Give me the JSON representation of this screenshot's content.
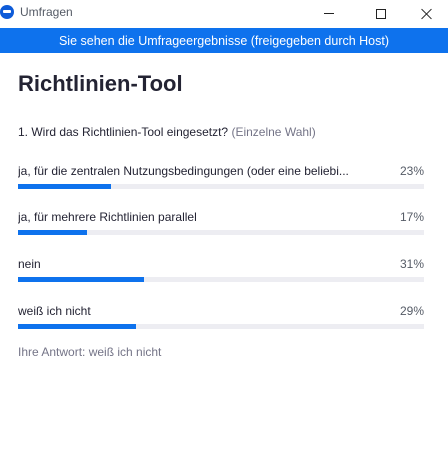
{
  "window": {
    "title": "Umfragen"
  },
  "banner": {
    "text": "Sie sehen die Umfrageergebnisse (freigegeben durch Host)"
  },
  "poll": {
    "title": "Richtlinien-Tool",
    "question": "1. Wird das Richtlinien-Tool eingesetzt?",
    "question_type": "(Einzelne Wahl)",
    "options": [
      {
        "label": "ja, für die zentralen Nutzungsbedingungen (oder eine beliebi...",
        "percent_label": "23%",
        "percent": 23
      },
      {
        "label": "ja, für mehrere Richtlinien parallel",
        "percent_label": "17%",
        "percent": 17
      },
      {
        "label": "nein",
        "percent_label": "31%",
        "percent": 31
      },
      {
        "label": "weiß ich nicht",
        "percent_label": "29%",
        "percent": 29
      }
    ],
    "your_answer": "Ihre Antwort: weiß ich nicht"
  },
  "colors": {
    "accent": "#0e72ed",
    "track": "#ededf2",
    "text": "#232333",
    "muted": "#747487"
  },
  "icons": {
    "app": "zoom-app-icon",
    "minimize": "minimize-icon",
    "maximize": "maximize-icon",
    "close": "close-icon"
  }
}
